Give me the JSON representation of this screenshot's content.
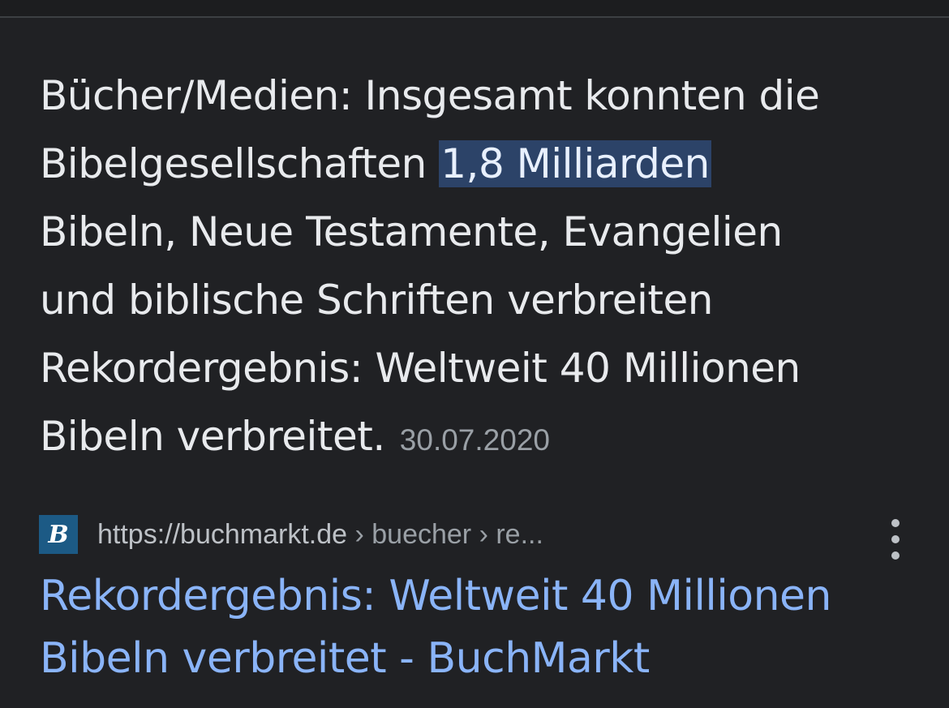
{
  "snippet": {
    "line1": "Bücher/Medien: Insgesamt konnten die",
    "line2_before": "Bibelgesellschaften ",
    "line2_highlight": "1,8 Milliarden",
    "line3": "Bibeln, Neue Testamente, Evangelien",
    "line4": "und biblische Schriften verbreiten",
    "line5": "Rekordergebnis: Weltweit 40 Millionen",
    "line6": "Bibeln verbreitet.",
    "date": "30.07.2020"
  },
  "source": {
    "favicon_letter": "B",
    "url": "https://buchmarkt.de",
    "breadcrumb": " › buecher › re..."
  },
  "result": {
    "title_line1": "Rekordergebnis: Weltweit 40 Millionen",
    "title_line2": "Bibeln verbreitet - BuchMarkt"
  },
  "colors": {
    "background": "#202124",
    "text": "#e8eaed",
    "link": "#8ab4f8",
    "highlight": "#2c4368",
    "favicon": "#1c5a85"
  },
  "icons": {
    "more": "more-vert-icon",
    "favicon": "buchmarkt-favicon-icon"
  }
}
